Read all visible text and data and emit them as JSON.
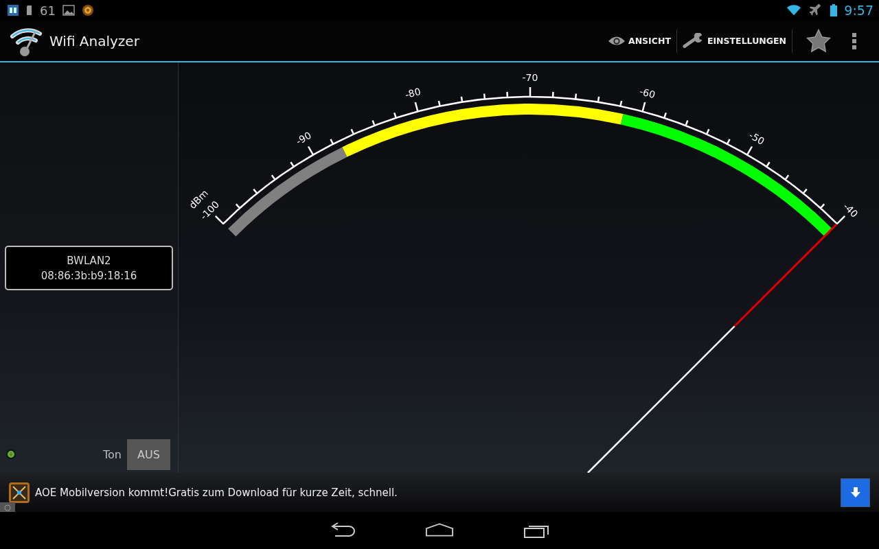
{
  "status_bar": {
    "notification_count": "61",
    "time": "9:57"
  },
  "action_bar": {
    "title": "Wifi Analyzer",
    "actions": [
      {
        "label": "ANSICHT",
        "kind": "eye"
      },
      {
        "label": "EINSTELLUNGEN",
        "kind": "wrench"
      }
    ]
  },
  "network": {
    "ssid": "BWLAN2",
    "mac": "08:86:3b:b9:18:16"
  },
  "sound": {
    "label": "Ton",
    "button": "AUS"
  },
  "gauge": {
    "unit": "dBm",
    "ticks": [
      "-100",
      "-90",
      "-80",
      "-70",
      "-60",
      "-50",
      "-40"
    ],
    "level": 1.0,
    "zones": [
      {
        "color": "#808080"
      },
      {
        "color": "#ffff00"
      },
      {
        "color": "#00ff00"
      }
    ]
  },
  "ad": {
    "text": "AOE Mobilversion kommt!Gratis zum Download für kurze Zeit, schnell."
  }
}
